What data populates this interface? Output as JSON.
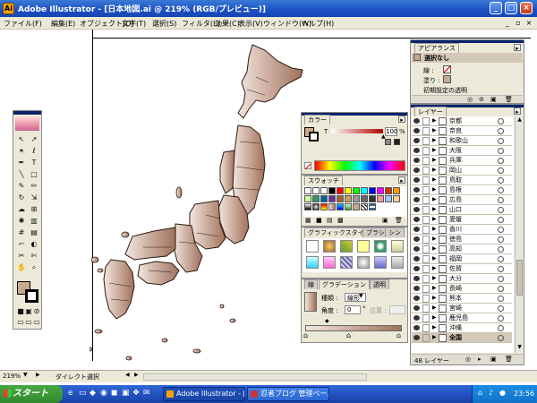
{
  "window": {
    "app_icon": "Ai",
    "title": "Adobe Illustrator - [日本地図.ai @ 219% (RGB/プレビュー)]",
    "min": "_",
    "max": "□",
    "close": "×"
  },
  "menu": [
    "ファイル(F)",
    "編集(E)",
    "オブジェクト(O)",
    "文字(T)",
    "選択(S)",
    "フィルタ(L)",
    "効果(C)",
    "表示(V)",
    "ウィンドウ(W)",
    "ヘルプ(H)"
  ],
  "appearance_panel": {
    "tab": "アピアランス",
    "selection": "選択なし",
    "stroke_label": "線 :",
    "fill_label": "塗り :",
    "opacity_label": "初期設定の透明"
  },
  "color_panel": {
    "tab": "カラー",
    "channel": "T",
    "value": "100",
    "unit": "%"
  },
  "swatches_panel": {
    "tab": "スウォッチ"
  },
  "graphic_styles_panel": {
    "tab": "グラフィックスタイル",
    "tab2": "ブラシ",
    "tab3": "シン"
  },
  "gradient_panel": {
    "tab_stroke": "線",
    "tab": "グラデーション",
    "tab_trans": "透明",
    "type_label": "種類 :",
    "type_value": "線形",
    "angle_label": "角度 :",
    "angle_value": "0",
    "location_label": "位置 :",
    "degree": "°"
  },
  "layers_panel": {
    "tab": "レイヤー",
    "count": "48 レイヤー",
    "layers": [
      "京都",
      "奈良",
      "和歌山",
      "大阪",
      "兵庫",
      "岡山",
      "鳥取",
      "島根",
      "広島",
      "山口",
      "愛媛",
      "香川",
      "徳島",
      "高知",
      "福岡",
      "佐賀",
      "大分",
      "長崎",
      "熊本",
      "宮崎",
      "鹿児島",
      "沖縄",
      "全国"
    ]
  },
  "statusbar": {
    "zoom": "219%",
    "tool": "ダイレクト選択"
  },
  "taskbar": {
    "start": "スタート",
    "tasks": [
      "Adobe Illustrator - [...",
      "忍者ブログ 管理ペー..."
    ],
    "clock": "23:56"
  },
  "colors": {
    "land_light": "#f3e6de",
    "land_dark": "#a0705a",
    "fill_swatch": "#c9a98c"
  }
}
